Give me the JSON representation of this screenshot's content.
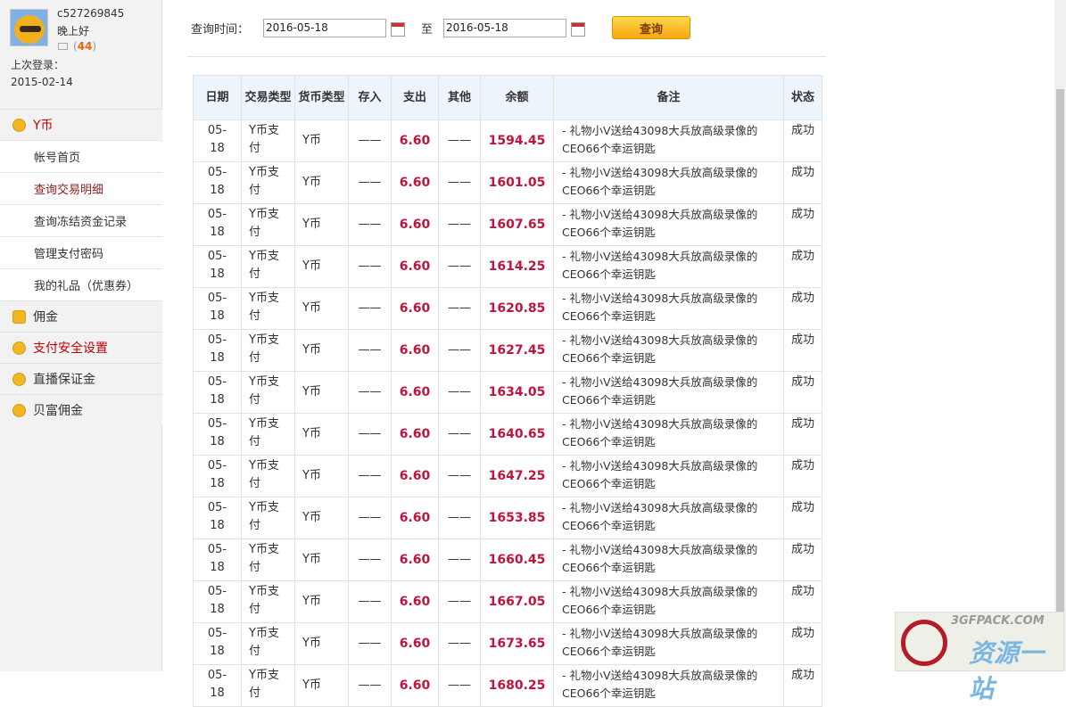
{
  "user": {
    "name": "c527269845",
    "greeting": "晚上好",
    "message_count": "44",
    "last_login_label": "上次登录：",
    "last_login_date": "2015-02-14"
  },
  "nav": {
    "ybi": "Y币",
    "ybi_items": [
      "帐号首页",
      "查询交易明细",
      "查询冻结资金记录",
      "管理支付密码",
      "我的礼品（优惠券）"
    ],
    "yongjin": "佣金",
    "pay_security": "支付安全设置",
    "deposit": "直播保证金",
    "beifu": "贝富佣金"
  },
  "query": {
    "label": "查询时间：",
    "start": "2016-05-18",
    "to": "至",
    "end": "2016-05-18",
    "button": "查询"
  },
  "table": {
    "headers": [
      "日期",
      "交易类型",
      "货币类型",
      "存入",
      "支出",
      "其他",
      "余额",
      "备注",
      "状态"
    ],
    "rows": [
      {
        "date": "05-18",
        "type": "Y币支付",
        "currency": "Y币",
        "in": "——",
        "out": "6.60",
        "other": "——",
        "balance": "1594.45",
        "note": "- 礼物小V送给43098大兵放高级录像的CEO66个幸运钥匙",
        "status": "成功"
      },
      {
        "date": "05-18",
        "type": "Y币支付",
        "currency": "Y币",
        "in": "——",
        "out": "6.60",
        "other": "——",
        "balance": "1601.05",
        "note": "- 礼物小V送给43098大兵放高级录像的CEO66个幸运钥匙",
        "status": "成功"
      },
      {
        "date": "05-18",
        "type": "Y币支付",
        "currency": "Y币",
        "in": "——",
        "out": "6.60",
        "other": "——",
        "balance": "1607.65",
        "note": "- 礼物小V送给43098大兵放高级录像的CEO66个幸运钥匙",
        "status": "成功"
      },
      {
        "date": "05-18",
        "type": "Y币支付",
        "currency": "Y币",
        "in": "——",
        "out": "6.60",
        "other": "——",
        "balance": "1614.25",
        "note": "- 礼物小V送给43098大兵放高级录像的CEO66个幸运钥匙",
        "status": "成功"
      },
      {
        "date": "05-18",
        "type": "Y币支付",
        "currency": "Y币",
        "in": "——",
        "out": "6.60",
        "other": "——",
        "balance": "1620.85",
        "note": "- 礼物小V送给43098大兵放高级录像的CEO66个幸运钥匙",
        "status": "成功"
      },
      {
        "date": "05-18",
        "type": "Y币支付",
        "currency": "Y币",
        "in": "——",
        "out": "6.60",
        "other": "——",
        "balance": "1627.45",
        "note": "- 礼物小V送给43098大兵放高级录像的CEO66个幸运钥匙",
        "status": "成功"
      },
      {
        "date": "05-18",
        "type": "Y币支付",
        "currency": "Y币",
        "in": "——",
        "out": "6.60",
        "other": "——",
        "balance": "1634.05",
        "note": "- 礼物小V送给43098大兵放高级录像的CEO66个幸运钥匙",
        "status": "成功"
      },
      {
        "date": "05-18",
        "type": "Y币支付",
        "currency": "Y币",
        "in": "——",
        "out": "6.60",
        "other": "——",
        "balance": "1640.65",
        "note": "- 礼物小V送给43098大兵放高级录像的CEO66个幸运钥匙",
        "status": "成功"
      },
      {
        "date": "05-18",
        "type": "Y币支付",
        "currency": "Y币",
        "in": "——",
        "out": "6.60",
        "other": "——",
        "balance": "1647.25",
        "note": "- 礼物小V送给43098大兵放高级录像的CEO66个幸运钥匙",
        "status": "成功"
      },
      {
        "date": "05-18",
        "type": "Y币支付",
        "currency": "Y币",
        "in": "——",
        "out": "6.60",
        "other": "——",
        "balance": "1653.85",
        "note": "- 礼物小V送给43098大兵放高级录像的CEO66个幸运钥匙",
        "status": "成功"
      },
      {
        "date": "05-18",
        "type": "Y币支付",
        "currency": "Y币",
        "in": "——",
        "out": "6.60",
        "other": "——",
        "balance": "1660.45",
        "note": "- 礼物小V送给43098大兵放高级录像的CEO66个幸运钥匙",
        "status": "成功"
      },
      {
        "date": "05-18",
        "type": "Y币支付",
        "currency": "Y币",
        "in": "——",
        "out": "6.60",
        "other": "——",
        "balance": "1667.05",
        "note": "- 礼物小V送给43098大兵放高级录像的CEO66个幸运钥匙",
        "status": "成功"
      },
      {
        "date": "05-18",
        "type": "Y币支付",
        "currency": "Y币",
        "in": "——",
        "out": "6.60",
        "other": "——",
        "balance": "1673.65",
        "note": "- 礼物小V送给43098大兵放高级录像的CEO66个幸运钥匙",
        "status": "成功"
      },
      {
        "date": "05-18",
        "type": "Y币支付",
        "currency": "Y币",
        "in": "——",
        "out": "6.60",
        "other": "——",
        "balance": "1680.25",
        "note": "- 礼物小V送给43098大兵放高级录像的CEO66个幸运钥匙",
        "status": "成功"
      }
    ]
  },
  "watermark": {
    "site": "3GFPACK.COM",
    "brand": "资源一站"
  },
  "colors": {
    "amount": "#c0143c",
    "active_nav": "#c00000",
    "button": "#f6a70f"
  }
}
